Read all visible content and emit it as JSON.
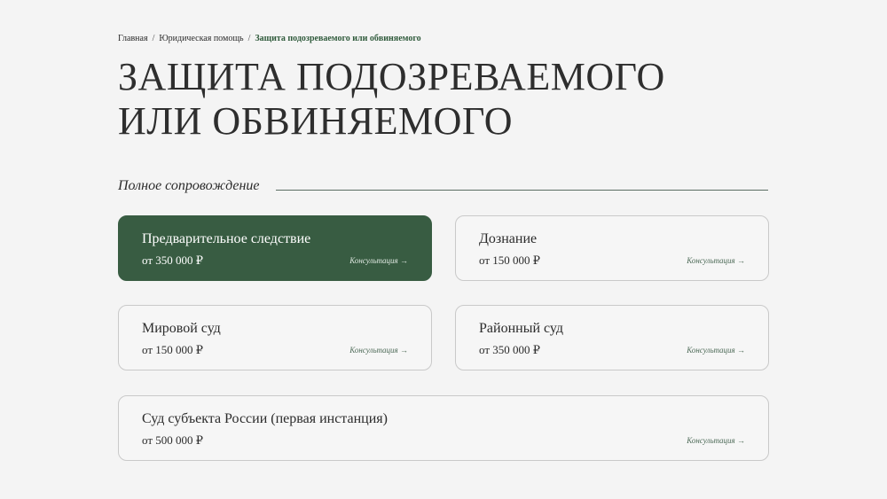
{
  "breadcrumb": {
    "home": "Главная",
    "parent": "Юридическая помощь",
    "current": "Защита подозреваемого или обвиняемого",
    "separator": "/"
  },
  "title": {
    "line1": "ЗАЩИТА ПОДОЗРЕВАЕМОГО",
    "line2": "ИЛИ ОБВИНЯЕМОГО"
  },
  "section": {
    "label": "Полное сопровождение"
  },
  "cards": [
    {
      "name": "Предварительное следствие",
      "price": "от 350 000 ₽",
      "cta": "Консультация →"
    },
    {
      "name": "Дознание",
      "price": "от 150 000 ₽",
      "cta": "Консультация →"
    },
    {
      "name": "Мировой суд",
      "price": "от 150 000 ₽",
      "cta": "Консультация →"
    },
    {
      "name": "Районный суд",
      "price": "от 350 000 ₽",
      "cta": "Консультация →"
    },
    {
      "name": "Суд субъекта России (первая инстанция)",
      "price": "от 500 000 ₽",
      "cta": "Консультация →"
    }
  ],
  "colors": {
    "accent": "#385c42",
    "background": "#f4f4f4"
  }
}
